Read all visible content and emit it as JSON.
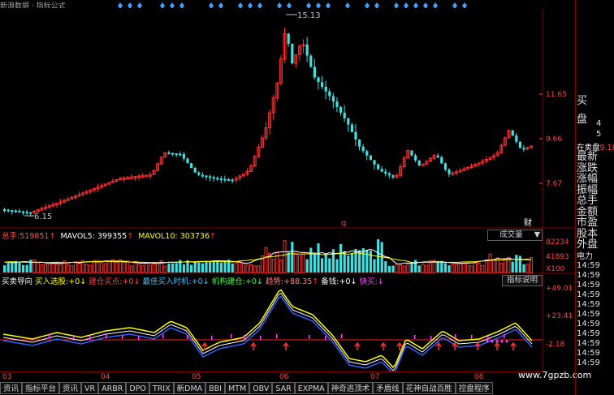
{
  "app": {
    "window_title": "新浪数据 · 指标公式"
  },
  "price_panel": {
    "high_label": "15.13",
    "low_label": "6.15",
    "axis_ticks": [
      "11.65",
      "9.66",
      "7.67"
    ],
    "marker_q": "q",
    "marker_cai": "财"
  },
  "volume_panel": {
    "header": [
      {
        "label": "总手:",
        "value": "519851",
        "color": "#ff5050"
      },
      {
        "label": "MAVOL5:",
        "value": "399355",
        "color": "#ffffff"
      },
      {
        "label": "MAVOL10:",
        "value": "303736",
        "color": "#ffffff"
      }
    ],
    "selector": "成交量",
    "axis_ticks": [
      "82234",
      "41893",
      "X100"
    ]
  },
  "indicator_panel": {
    "header": [
      {
        "label": "买卖导向",
        "value": "",
        "color": "#ffffff"
      },
      {
        "label": "买入选股:",
        "value": "+0",
        "color": "#ffff00"
      },
      {
        "label": "建仓买点:",
        "value": "+0",
        "color": "#ff4040"
      },
      {
        "label": "最佳买入时机:",
        "value": "+0",
        "color": "#40c0ff"
      },
      {
        "label": "机构建仓:",
        "value": "+0",
        "color": "#40ff40"
      },
      {
        "label": "趋势:",
        "value": "+88.35",
        "color": "#ff8080"
      },
      {
        "label": "备钱:",
        "value": "+0",
        "color": "#ffffff"
      },
      {
        "label": "快买:",
        "value": "",
        "color": "#ff40ff"
      }
    ],
    "button": "指标说明",
    "axis_ticks": [
      "+49.01",
      "+23.41",
      "-2.18"
    ]
  },
  "x_axis": {
    "months": [
      "03",
      "04",
      "05",
      "06",
      "07",
      "08"
    ]
  },
  "side_panel": {
    "top_chars": [
      "买",
      "盘"
    ],
    "top_nums": [
      "4",
      "5"
    ],
    "sell_label": "在卖盘",
    "sell_value": "9.18",
    "fields": [
      "最新",
      "涨跌",
      "涨幅",
      "振幅",
      "总手",
      "金额",
      "市盈",
      "股本",
      "外盘"
    ],
    "power_label": "电力",
    "times": [
      "14:59",
      "14:59",
      "14:59",
      "14:59",
      "14:59",
      "14:59",
      "14:59",
      "14:59",
      "14:59",
      "14:59",
      "14:59"
    ]
  },
  "tabs": [
    "资讯",
    "指标平台",
    "资讯",
    "VR",
    "ARBR",
    "DPO",
    "TRIX",
    "新DMA",
    "BBI",
    "MTM",
    "OBV",
    "SAR",
    "EXPMA",
    "神奇逃顶术",
    "矛盾线",
    "花神自战百胜",
    "控盘程序"
  ],
  "watermark": "www.7gpzb.com",
  "colors": {
    "up": "#ff3030",
    "down": "#40e0e0",
    "grid": "#800000",
    "bg": "#000000"
  }
}
